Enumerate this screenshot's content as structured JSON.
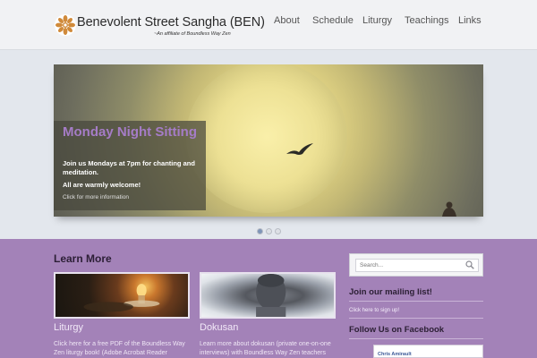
{
  "header": {
    "title": "Benevolent Street Sangha (BEN)",
    "subtitle": "~An affiliate of Boundless Way Zen",
    "nav": [
      "About",
      "Schedule",
      "Liturgy",
      "Teachings",
      "Links"
    ]
  },
  "slider": {
    "caption_title": "Monday Night Sitting",
    "caption_text": "Join us Mondays at 7pm for chanting and meditation.",
    "caption_text2": "All are warmly welcome!",
    "caption_link": "Click for more information",
    "active_slide": 1,
    "slide_count": 3
  },
  "learn_more": {
    "heading": "Learn More",
    "cards": [
      {
        "title": "Liturgy",
        "desc": "Click here for a free PDF of the Boundless Way Zen liturgy book! (Adobe Acrobat Reader"
      },
      {
        "title": "Dokusan",
        "desc": "Learn more about dokusan (private one-on-one interviews) with Boundless Way Zen teachers"
      }
    ]
  },
  "sidebar": {
    "search_placeholder": "Search...",
    "mailing_heading": "Join our mailing list!",
    "mailing_link": "Click here to sign up!",
    "facebook_heading": "Follow Us on Facebook",
    "facebook_name": "Chris Amirault"
  },
  "colors": {
    "accent_purple": "#a382b8",
    "caption_title": "#a57cc6",
    "nav_text": "#555555"
  }
}
